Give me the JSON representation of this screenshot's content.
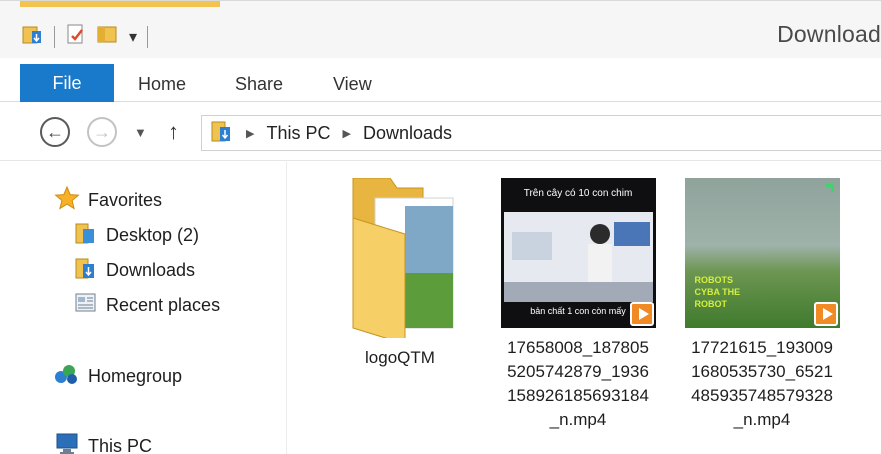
{
  "window": {
    "title": "Download"
  },
  "ribbon": {
    "tabs": [
      {
        "label": "File"
      },
      {
        "label": "Home"
      },
      {
        "label": "Share"
      },
      {
        "label": "View"
      }
    ]
  },
  "address": {
    "crumbs": [
      {
        "label": "This PC"
      },
      {
        "label": "Downloads"
      }
    ]
  },
  "navpane": {
    "favorites_label": "Favorites",
    "favorites": [
      {
        "label": "Desktop (2)"
      },
      {
        "label": "Downloads"
      },
      {
        "label": "Recent places"
      }
    ],
    "homegroup_label": "Homegroup",
    "thispc_label": "This PC"
  },
  "content": {
    "items": [
      {
        "name_lines": [
          "logoQTM"
        ],
        "type": "folder"
      },
      {
        "name_lines": [
          "17658008_187805",
          "5205742879_1936",
          "158926185693184",
          "_n.mp4"
        ],
        "type": "video",
        "thumb_caption_top": "Trên cây có 10 con chim",
        "thumb_caption_bottom": "bản chất 1 con còn mấy"
      },
      {
        "name_lines": [
          "17721615_193009",
          "1680535730_6521",
          "485935748579328",
          "_n.mp4"
        ],
        "type": "video",
        "thumb_overlay_lines": [
          "ROBOTS",
          "CYBA THE",
          "ROBOT"
        ]
      }
    ]
  },
  "colors": {
    "file_tab": "#1979ca",
    "folder_yellow": "#f3c24f",
    "play_badge": "#f08a24"
  }
}
